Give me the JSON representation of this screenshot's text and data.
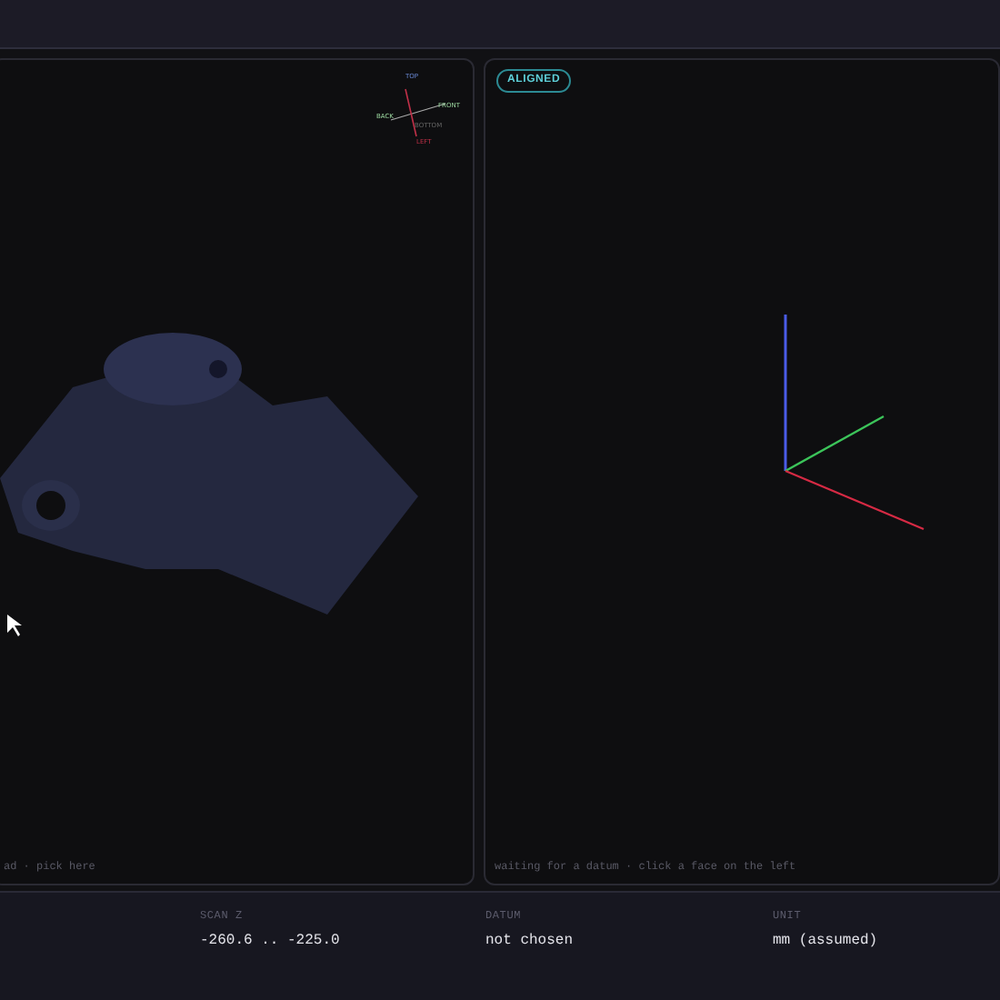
{
  "left_viewport": {
    "gizmo_labels": [
      {
        "text": "TOP",
        "kind": "top"
      },
      {
        "text": "BACK",
        "kind": "left"
      },
      {
        "text": "FRONT",
        "kind": "right"
      },
      {
        "text": "BOTTOM",
        "kind": "bottom"
      },
      {
        "text": "LEFT",
        "kind": "under"
      }
    ],
    "caption": "ad · pick here"
  },
  "right_viewport": {
    "badge": "ALIGNED",
    "caption": "waiting for a datum · click a face on the left"
  },
  "status_bar": [
    {
      "label": "SCAN Z",
      "value": "-260.6 .. -225.0"
    },
    {
      "label": "DATUM",
      "value": "not chosen"
    },
    {
      "label": "UNIT",
      "value": "mm (assumed)"
    }
  ]
}
